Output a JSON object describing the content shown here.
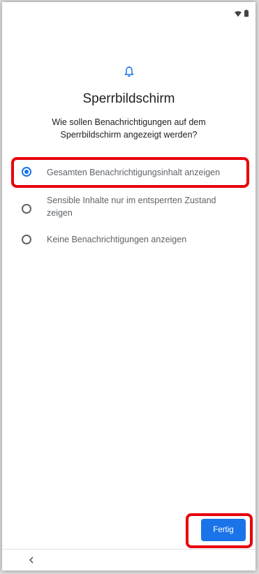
{
  "header": {
    "icon": "bell-icon",
    "title": "Sperrbildschirm",
    "subtitle": "Wie sollen Benachrichtigungen auf dem Sperrbildschirm angezeigt werden?"
  },
  "options": [
    {
      "label": "Gesamten Benachrichtigungsinhalt anzeigen",
      "selected": true
    },
    {
      "label": "Sensible Inhalte nur im entsperrten Zustand zeigen",
      "selected": false
    },
    {
      "label": "Keine Benachrichtigungen anzeigen",
      "selected": false
    }
  ],
  "footer": {
    "done_label": "Fertig"
  },
  "status_bar": {
    "icons": [
      "wifi-icon",
      "battery-icon"
    ]
  },
  "nav_bar": {
    "icons": [
      "back-chevron-icon"
    ]
  },
  "colors": {
    "accent": "#1a73e8",
    "highlight": "#e8000b",
    "text_primary": "#202124",
    "text_secondary": "#5f6368"
  }
}
